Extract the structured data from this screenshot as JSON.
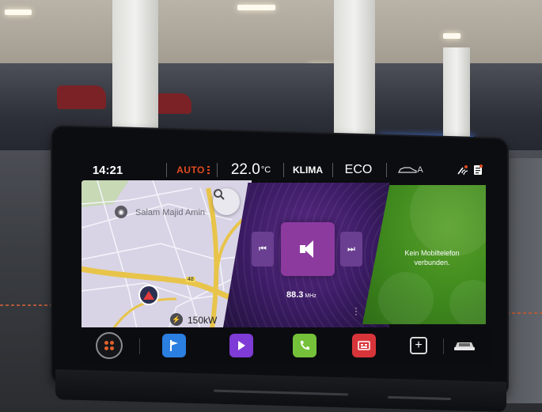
{
  "statusbar": {
    "time": "14:21",
    "auto": "AUTO",
    "temp_value": "22.0",
    "temp_unit": "°C",
    "klima": "KLIMA",
    "eco": "ECO",
    "car_mode": "A",
    "icons": [
      "voice-signal-icon",
      "notification-icon"
    ]
  },
  "map": {
    "place_label": "Salam Majid Amin",
    "route_number": "48",
    "charger_power": "150kW",
    "icons": [
      "search-icon",
      "camera-poi-icon",
      "charger-icon",
      "navigation-arrow-icon"
    ]
  },
  "media": {
    "frequency": "88.3",
    "frequency_unit": "MHz",
    "icons": [
      "previous-icon",
      "speaker-icon",
      "next-icon",
      "more-icon"
    ]
  },
  "phone": {
    "status_line1": "Kein Mobiltelefon",
    "status_line2": "verbunden."
  },
  "dock": {
    "items": [
      "menu-icon",
      "navigation-icon",
      "media-icon",
      "phone-icon",
      "app-icon",
      "add-icon",
      "car-icon"
    ]
  },
  "colors": {
    "accent_orange": "#e04a1f",
    "media_purple": "#5b2b86",
    "phone_green": "#4f9626",
    "nav_blue": "#2a7fe0"
  }
}
